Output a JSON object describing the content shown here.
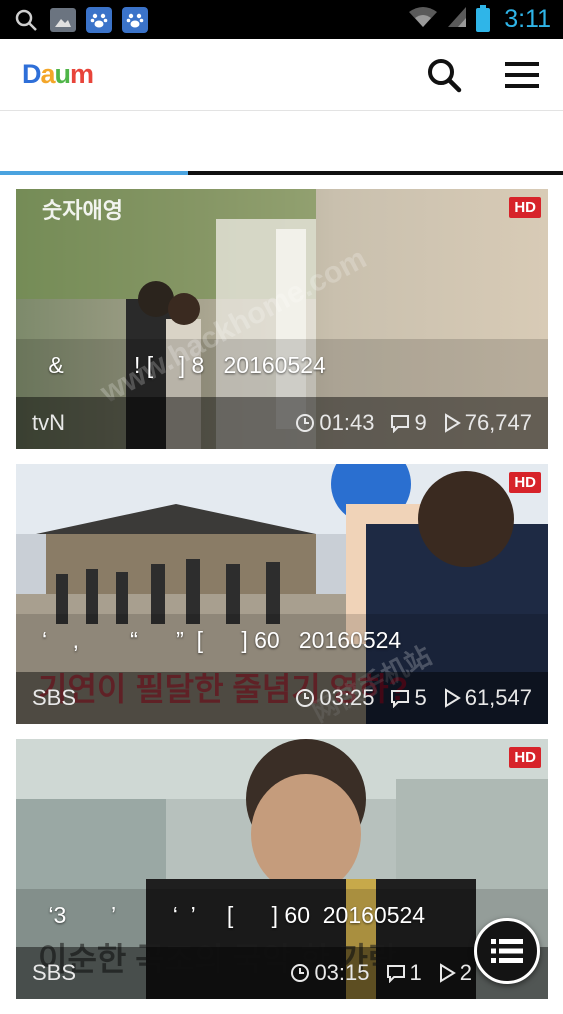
{
  "status_bar": {
    "time": "3:11",
    "icons": [
      "search-icon",
      "image-icon",
      "baidu-paw-icon",
      "baidu-paw-icon",
      "wifi-icon",
      "signal-icon",
      "battery-icon"
    ]
  },
  "header": {
    "logo_text": "Daum",
    "search_icon": "search-icon",
    "menu_icon": "hamburger-menu-icon"
  },
  "tabs": {
    "active_color": "#4aa3df"
  },
  "cards": [
    {
      "title": " &           ! [    ] 8   20160524",
      "channel": "tvN",
      "duration": "01:43",
      "comments": "9",
      "views": "76,747",
      "badge": "HD",
      "overlay_text": "",
      "logo_text": "숫자애영"
    },
    {
      "title": "‘    ,        “      ”  [      ] 60   20160524",
      "channel": "SBS",
      "duration": "03:25",
      "comments": "5",
      "views": "61,547",
      "badge": "HD",
      "overlay_text": "기연이 필달한 줄념기 영하?"
    },
    {
      "title": " ‘3       ’         ‘  ’     [      ] 60  20160524",
      "channel": "SBS",
      "duration": "03:15",
      "comments": "1",
      "views": "2",
      "badge": "HD",
      "overlay_text": "이순한 곡조의 국악 한 가락"
    }
  ],
  "watermark": "www.hackhome.com",
  "watermark_cn": "网侠手机站",
  "fab_icon": "list-icon"
}
